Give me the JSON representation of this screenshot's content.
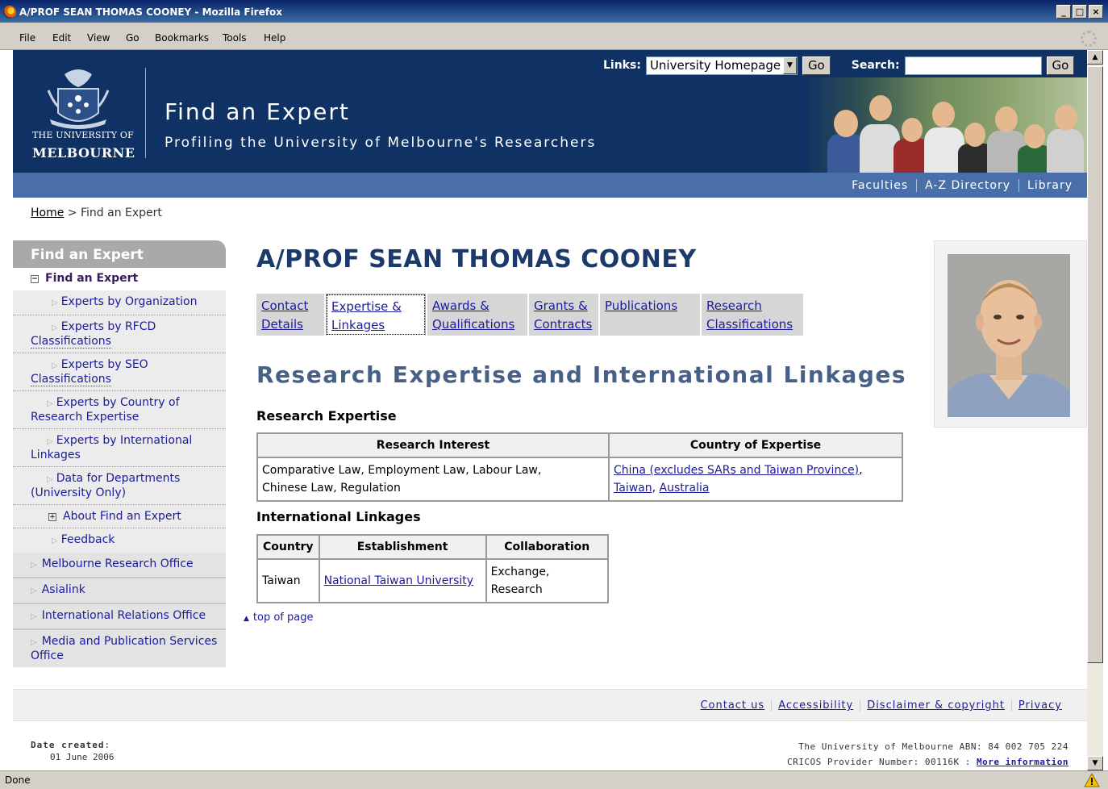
{
  "window": {
    "title": "A/PROF SEAN THOMAS COONEY - Mozilla Firefox",
    "buttons": [
      "_",
      "□",
      "×"
    ]
  },
  "menu": [
    "File",
    "Edit",
    "View",
    "Go",
    "Bookmarks",
    "Tools",
    "Help"
  ],
  "header": {
    "links_label": "Links:",
    "links_selected": "University Homepage",
    "go_label": "Go",
    "search_label": "Search:",
    "search_value": "",
    "search_go_label": "Go",
    "uni_line1": "THE UNIVERSITY OF",
    "uni_line2": "MELBOURNE",
    "site_title": "Find an Expert",
    "site_subtitle": "Profiling the University of Melbourne's Researchers"
  },
  "subnav": [
    "Faculties",
    "A-Z Directory",
    "Library"
  ],
  "breadcrumb": {
    "home": "Home",
    "sep": " > ",
    "current": "Find an Expert"
  },
  "leftnav": {
    "heading": "Find an Expert",
    "selected": "Find an Expert",
    "sub_items": [
      "Experts by Organization",
      "Experts by RFCD",
      "Classifications",
      "Experts by SEO",
      "Classifications",
      "Experts by Country of Research Expertise",
      "Experts by International Linkages",
      "Data for Departments (University Only)",
      "About Find an Expert",
      "Feedback"
    ],
    "top_items": [
      "Melbourne Research Office",
      "Asialink",
      "International Relations Office",
      "Media and Publication Services Office"
    ]
  },
  "main": {
    "person_name": "A/PROF SEAN THOMAS COONEY",
    "tabs": [
      {
        "line1": "Contact",
        "line2": "Details"
      },
      {
        "line1": "Expertise &",
        "line2": "Linkages"
      },
      {
        "line1": "Awards &",
        "line2": "Qualifications"
      },
      {
        "line1": "Grants &",
        "line2": "Contracts"
      },
      {
        "line1": "Publications",
        "line2": ""
      },
      {
        "line1": "Research",
        "line2": "Classifications"
      }
    ],
    "section_title": "Research Expertise and International Linkages",
    "expertise_heading": "Research Expertise",
    "expertise_headers": [
      "Research Interest",
      "Country of Expertise"
    ],
    "expertise_row": {
      "interest_line1": "Comparative Law, Employment Law, Labour Law,",
      "interest_line2": "Chinese Law, Regulation",
      "country1": "China (excludes SARs and Taiwan Province)",
      "comma1": ",",
      "country2": "Taiwan",
      "comma2": ", ",
      "country3": "Australia"
    },
    "linkages_heading": "International Linkages",
    "linkages_headers": [
      "Country",
      "Establishment",
      "Collaboration"
    ],
    "linkages_row": [
      "Taiwan",
      "National Taiwan University",
      "Exchange, Research"
    ],
    "top_of_page": "top of page"
  },
  "footer": {
    "links": [
      "Contact us",
      "Accessibility",
      "Disclaimer & copyright",
      "Privacy"
    ],
    "date_created_label": "Date created",
    "date_created_colon": ":",
    "date_created": "01 June 2006",
    "abn_line": "The University of Melbourne ABN: 84 002 705 224",
    "cricos_line": "CRICOS Provider Number: 00116K : ",
    "more_info": "More information"
  },
  "status": {
    "text": "Done"
  },
  "colors": {
    "header_blue": "#0f3163",
    "subnav_blue": "#4a6fa8",
    "link": "#1b1b9a",
    "title_blue": "#1b3a6b"
  }
}
